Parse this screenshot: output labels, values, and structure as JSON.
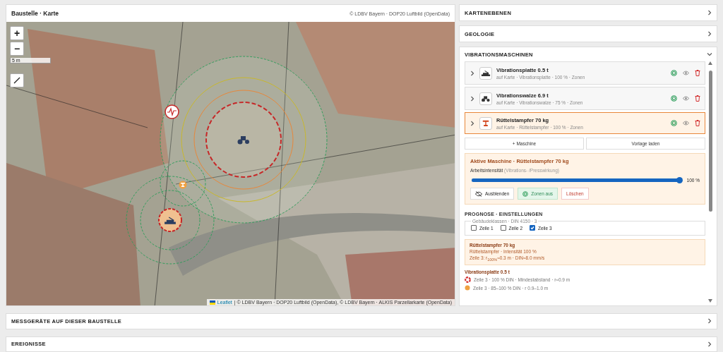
{
  "map_panel": {
    "title": "Baustelle · Karte",
    "source": "© LDBV Bayern · DOP20 Luftbild (OpenData)",
    "zoom_in": "+",
    "zoom_out": "−",
    "scale": "5 m",
    "attribution_link": "Leaflet",
    "attribution": "| © LDBV Bayern · DOP20 Luftbild (OpenData), © LDBV Bayern · ALKIS Parzellarkarte (OpenData)"
  },
  "sections": [
    {
      "title": "KARTENEBENEN",
      "expanded": false
    },
    {
      "title": "GEOLOGIE",
      "expanded": false
    }
  ],
  "machines_section": {
    "title": "VIBRATIONSMASCHINEN",
    "expanded": true,
    "machines": [
      {
        "kind": "plate",
        "name": "Vibrationsplatte 0.5 t",
        "details": "auf Karte · Vibrationsplatte · 100 % · Zonen",
        "selected": false
      },
      {
        "kind": "roller",
        "name": "Vibrationswalze 6.9 t",
        "details": "auf Karte · Vibrationswalze · 75 % · Zonen",
        "selected": false
      },
      {
        "kind": "rammer",
        "name": "Rüttelstampfer 70 kg",
        "details": "auf Karte · Rüttelstampfer · 100 % · Zonen",
        "selected": true
      }
    ],
    "add_button": "+ Maschine",
    "template_button": "Vorlage laden",
    "active": {
      "title": "Aktive Maschine · Rüttelstampfer 70 kg",
      "label": "Arbeitsintensität",
      "hint": "(Vibrations- /Presswirkung)",
      "level": 1,
      "reading": "100 %",
      "buttons": [
        {
          "kind": "hide",
          "label": "Ausblenden"
        },
        {
          "kind": "zones",
          "label": "Zonen aus"
        },
        {
          "kind": "delete",
          "label": "Löschen"
        }
      ]
    },
    "forecast": {
      "title": "PROGNOSE · EINSTELLUNGEN",
      "legend": "Gebäudeklassen · DIN 4150 · 3",
      "classes": [
        {
          "label": "Zeile 1",
          "checked": false
        },
        {
          "label": "Zeile 2",
          "checked": false
        },
        {
          "label": "Zeile 3",
          "checked": true
        }
      ],
      "result": {
        "title": "Rüttelstampfer 70 kg",
        "lines": [
          "Rüttelstampfer · Intensität 100 %",
          "Zeile 3: r$_{100%}$≈0.3 m · DIN≈8.0 mm/s"
        ]
      },
      "group": {
        "title": "Vibrationsplatte 0.5 t",
        "zones": [
          {
            "kind": "ring",
            "color": "#d32f2f",
            "text": "Zeile 3 · 100 % DIN · Mindestabstand · r≈0.9 m"
          },
          {
            "kind": "fill",
            "color": "#f0a040",
            "text": "Zeile 3 · 85–100 % DIN · r 0.9–1.0 m"
          }
        ]
      }
    }
  },
  "bottom_sections": [
    {
      "title": "MESSGERÄTE AUF DIESER BAUSTELLE",
      "expanded": false
    },
    {
      "title": "EREIGNISSE",
      "expanded": false
    }
  ]
}
